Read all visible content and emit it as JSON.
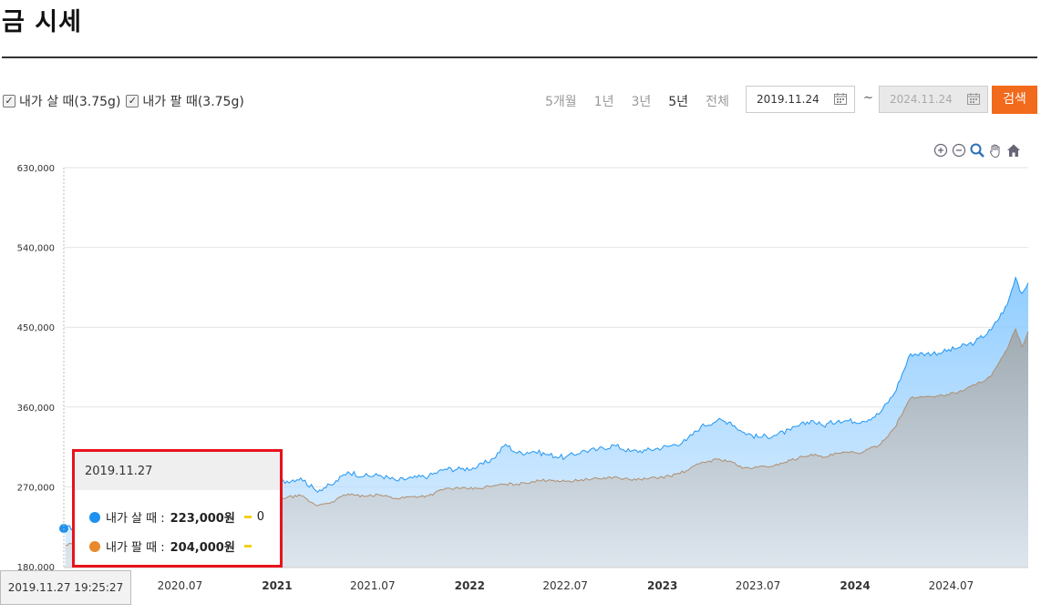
{
  "page": {
    "title": "금 시세"
  },
  "filters": {
    "buy_label": "내가 살 때(3.75g)",
    "sell_label": "내가 팔 때(3.75g)",
    "periods": [
      "5개월",
      "1년",
      "3년",
      "5년",
      "전체"
    ],
    "active_period": "5년",
    "date_from": "2019.11.24",
    "date_separator": "~",
    "date_to": "2024.11.24",
    "search_label": "검색"
  },
  "toolbar": {
    "icons": [
      "zoom-in-icon",
      "zoom-out-icon",
      "zoom-select-icon",
      "pan-hand-icon",
      "home-reset-icon"
    ]
  },
  "tooltip": {
    "date": "2019.11.27",
    "buy_label": "내가 살 때 :",
    "buy_value": "223,000원",
    "buy_diff": "0",
    "sell_label": "내가 팔 때 :",
    "sell_value": "204,000원"
  },
  "crosshair_label": "2019.11.27 19:25:27",
  "chart_data": {
    "type": "area",
    "ylim": [
      180000,
      630000
    ],
    "y_ticks": [
      "180,000",
      "270,000",
      "360,000",
      "450,000",
      "540,000",
      "630,000"
    ],
    "y_tick_values": [
      180000,
      270000,
      360000,
      450000,
      540000,
      630000
    ],
    "x_range": [
      "2019.11.24",
      "2024.11.24"
    ],
    "x_ticks": [
      {
        "label": "2020.07",
        "date": "2020-07-01",
        "bold": false
      },
      {
        "label": "2021",
        "date": "2021-01-01",
        "bold": true
      },
      {
        "label": "2021.07",
        "date": "2021-07-01",
        "bold": false
      },
      {
        "label": "2022",
        "date": "2022-01-01",
        "bold": true
      },
      {
        "label": "2022.07",
        "date": "2022-07-01",
        "bold": false
      },
      {
        "label": "2023",
        "date": "2023-01-01",
        "bold": true
      },
      {
        "label": "2023.07",
        "date": "2023-07-01",
        "bold": false
      },
      {
        "label": "2024",
        "date": "2024-01-01",
        "bold": true
      },
      {
        "label": "2024.07",
        "date": "2024-07-01",
        "bold": false
      }
    ],
    "series": [
      {
        "name": "내가 살 때",
        "color": "#2196f3",
        "points": [
          [
            "2019-11-27",
            223000
          ],
          [
            "2020-01-15",
            228000
          ],
          [
            "2020-03-01",
            240000
          ],
          [
            "2020-04-15",
            262000
          ],
          [
            "2020-05-15",
            262000
          ],
          [
            "2020-06-15",
            264000
          ],
          [
            "2020-07-15",
            270000
          ],
          [
            "2020-08-05",
            285000
          ],
          [
            "2020-09-01",
            276000
          ],
          [
            "2020-10-01",
            272000
          ],
          [
            "2020-11-01",
            274000
          ],
          [
            "2020-12-01",
            268000
          ],
          [
            "2021-01-05",
            275000
          ],
          [
            "2021-02-15",
            280000
          ],
          [
            "2021-03-15",
            266000
          ],
          [
            "2021-04-15",
            272000
          ],
          [
            "2021-05-15",
            287000
          ],
          [
            "2021-06-15",
            282000
          ],
          [
            "2021-07-15",
            283000
          ],
          [
            "2021-08-15",
            277000
          ],
          [
            "2021-09-15",
            280000
          ],
          [
            "2021-10-15",
            282000
          ],
          [
            "2021-11-15",
            290000
          ],
          [
            "2021-12-15",
            290000
          ],
          [
            "2022-01-15",
            292000
          ],
          [
            "2022-02-15",
            302000
          ],
          [
            "2022-03-10",
            318000
          ],
          [
            "2022-04-01",
            308000
          ],
          [
            "2022-05-01",
            310000
          ],
          [
            "2022-06-01",
            306000
          ],
          [
            "2022-07-01",
            303000
          ],
          [
            "2022-08-01",
            310000
          ],
          [
            "2022-09-01",
            312000
          ],
          [
            "2022-10-01",
            317000
          ],
          [
            "2022-11-01",
            310000
          ],
          [
            "2022-12-01",
            311000
          ],
          [
            "2023-01-15",
            316000
          ],
          [
            "2023-02-15",
            322000
          ],
          [
            "2023-03-15",
            338000
          ],
          [
            "2023-04-15",
            345000
          ],
          [
            "2023-05-10",
            343000
          ],
          [
            "2023-06-01",
            332000
          ],
          [
            "2023-07-01",
            326000
          ],
          [
            "2023-08-01",
            328000
          ],
          [
            "2023-09-01",
            334000
          ],
          [
            "2023-10-10",
            345000
          ],
          [
            "2023-11-01",
            339000
          ],
          [
            "2023-12-01",
            345000
          ],
          [
            "2024-01-15",
            344000
          ],
          [
            "2024-02-15",
            352000
          ],
          [
            "2024-03-15",
            375000
          ],
          [
            "2024-04-15",
            420000
          ],
          [
            "2024-05-15",
            420000
          ],
          [
            "2024-06-15",
            422000
          ],
          [
            "2024-07-15",
            427000
          ],
          [
            "2024-08-15",
            433000
          ],
          [
            "2024-09-15",
            447000
          ],
          [
            "2024-10-15",
            475000
          ],
          [
            "2024-10-31",
            506000
          ],
          [
            "2024-11-12",
            488000
          ],
          [
            "2024-11-24",
            500000
          ]
        ]
      },
      {
        "name": "내가 팔 때",
        "color": "#e8892b",
        "points": [
          [
            "2019-11-27",
            204000
          ],
          [
            "2020-01-15",
            210000
          ],
          [
            "2020-03-01",
            222000
          ],
          [
            "2020-04-15",
            240000
          ],
          [
            "2020-05-15",
            242000
          ],
          [
            "2020-06-15",
            246000
          ],
          [
            "2020-07-15",
            254000
          ],
          [
            "2020-08-05",
            260000
          ],
          [
            "2020-09-01",
            255000
          ],
          [
            "2020-10-01",
            252000
          ],
          [
            "2020-11-01",
            253000
          ],
          [
            "2020-12-01",
            250000
          ],
          [
            "2021-01-05",
            257000
          ],
          [
            "2021-02-15",
            260000
          ],
          [
            "2021-03-15",
            249000
          ],
          [
            "2021-04-15",
            253000
          ],
          [
            "2021-05-15",
            262000
          ],
          [
            "2021-06-15",
            259000
          ],
          [
            "2021-07-15",
            261000
          ],
          [
            "2021-08-15",
            257000
          ],
          [
            "2021-09-15",
            259000
          ],
          [
            "2021-10-15",
            260000
          ],
          [
            "2021-11-15",
            268000
          ],
          [
            "2021-12-15",
            268000
          ],
          [
            "2022-01-15",
            268000
          ],
          [
            "2022-02-15",
            271000
          ],
          [
            "2022-03-10",
            273000
          ],
          [
            "2022-04-01",
            273000
          ],
          [
            "2022-05-01",
            276000
          ],
          [
            "2022-06-01",
            278000
          ],
          [
            "2022-07-01",
            276000
          ],
          [
            "2022-08-01",
            278000
          ],
          [
            "2022-09-01",
            279000
          ],
          [
            "2022-10-01",
            281000
          ],
          [
            "2022-11-01",
            278000
          ],
          [
            "2022-12-01",
            279000
          ],
          [
            "2023-01-15",
            282000
          ],
          [
            "2023-02-15",
            288000
          ],
          [
            "2023-03-15",
            297000
          ],
          [
            "2023-04-15",
            301000
          ],
          [
            "2023-05-10",
            299000
          ],
          [
            "2023-06-01",
            291000
          ],
          [
            "2023-07-01",
            292000
          ],
          [
            "2023-08-01",
            294000
          ],
          [
            "2023-09-01",
            300000
          ],
          [
            "2023-10-10",
            307000
          ],
          [
            "2023-11-01",
            303000
          ],
          [
            "2023-12-01",
            308000
          ],
          [
            "2024-01-15",
            309000
          ],
          [
            "2024-02-15",
            317000
          ],
          [
            "2024-03-15",
            336000
          ],
          [
            "2024-04-15",
            370000
          ],
          [
            "2024-05-15",
            372000
          ],
          [
            "2024-06-15",
            373000
          ],
          [
            "2024-07-15",
            377000
          ],
          [
            "2024-08-15",
            385000
          ],
          [
            "2024-09-15",
            395000
          ],
          [
            "2024-10-15",
            425000
          ],
          [
            "2024-10-31",
            448000
          ],
          [
            "2024-11-12",
            428000
          ],
          [
            "2024-11-24",
            445000
          ]
        ]
      }
    ],
    "grid": true,
    "legend": "top-left"
  }
}
